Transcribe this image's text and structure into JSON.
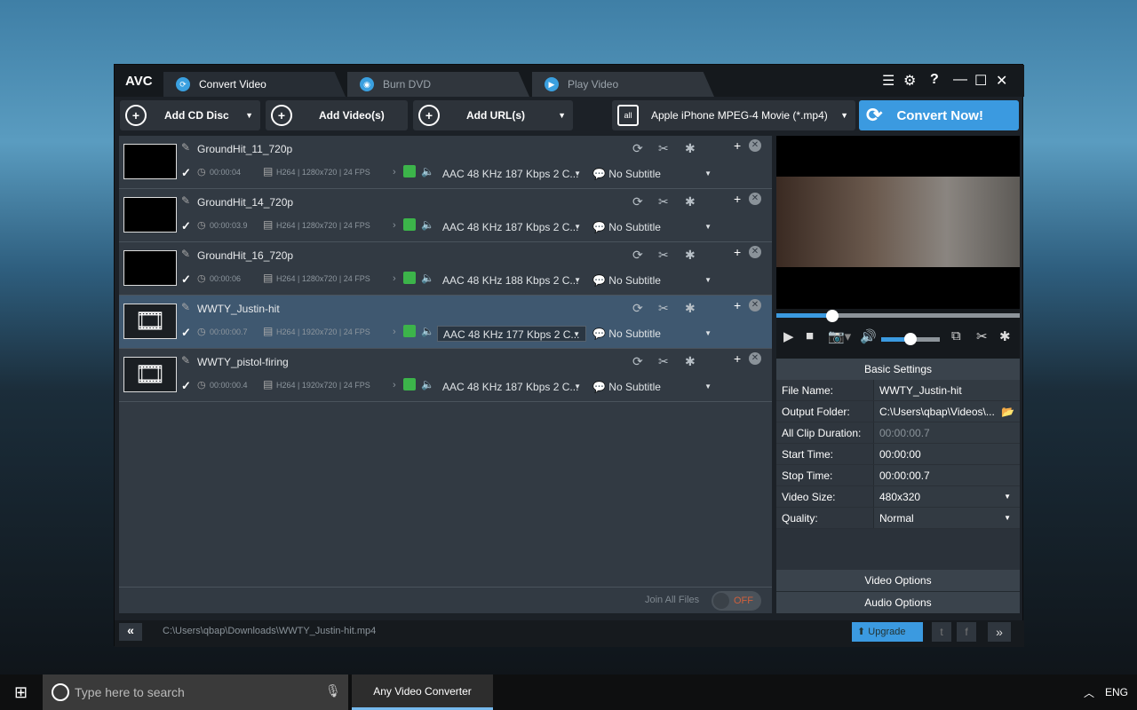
{
  "app": {
    "logo": "AVC",
    "tabs": [
      {
        "label": "Convert Video",
        "icon": "refresh-icon"
      },
      {
        "label": "Burn DVD",
        "icon": "disc-icon"
      },
      {
        "label": "Play Video",
        "icon": "play-icon"
      }
    ]
  },
  "toolbar": {
    "add_cd": "Add CD Disc",
    "add_video": "Add Video(s)",
    "add_url": "Add URL(s)",
    "profile": "Apple iPhone MPEG-4 Movie (*.mp4)",
    "convert": "Convert Now!"
  },
  "files": [
    {
      "name": "GroundHit_11_720p",
      "duration": "00:00:04",
      "video": "H264 | 1280x720 | 24 FPS",
      "audio": "AAC 48 KHz 187 Kbps 2 C...",
      "subtitle": "No Subtitle",
      "selected": false
    },
    {
      "name": "GroundHit_14_720p",
      "duration": "00:00:03.9",
      "video": "H264 | 1280x720 | 24 FPS",
      "audio": "AAC 48 KHz 187 Kbps 2 C...",
      "subtitle": "No Subtitle",
      "selected": false
    },
    {
      "name": "GroundHit_16_720p",
      "duration": "00:00:06",
      "video": "H264 | 1280x720 | 24 FPS",
      "audio": "AAC 48 KHz 188 Kbps 2 C...",
      "subtitle": "No Subtitle",
      "selected": false
    },
    {
      "name": "WWTY_Justin-hit",
      "duration": "00:00:00.7",
      "video": "H264 | 1920x720 | 24 FPS",
      "audio": "AAC 48 KHz 177 Kbps 2 C...",
      "subtitle": "No Subtitle",
      "selected": true
    },
    {
      "name": "WWTY_pistol-firing",
      "duration": "00:00:00.4",
      "video": "H264 | 1920x720 | 24 FPS",
      "audio": "AAC 48 KHz 187 Kbps 2 C...",
      "subtitle": "No Subtitle",
      "selected": false
    }
  ],
  "join": {
    "label": "Join All Files",
    "state": "OFF"
  },
  "player": {
    "progress": 0.23,
    "volume": 0.5
  },
  "settings": {
    "title": "Basic Settings",
    "rows": [
      {
        "k": "File Name:",
        "v": "WWTY_Justin-hit"
      },
      {
        "k": "Output Folder:",
        "v": "C:\\Users\\qbap\\Videos\\..."
      },
      {
        "k": "All Clip Duration:",
        "v": "00:00:00.7"
      },
      {
        "k": "Start Time:",
        "v": "00:00:00"
      },
      {
        "k": "Stop Time:",
        "v": "00:00:00.7"
      },
      {
        "k": "Video Size:",
        "v": "480x320"
      },
      {
        "k": "Quality:",
        "v": "Normal"
      }
    ],
    "video_options": "Video Options",
    "audio_options": "Audio Options"
  },
  "status": {
    "path": "C:\\Users\\qbap\\Downloads\\WWTY_Justin-hit.mp4",
    "upgrade": "Upgrade"
  },
  "taskbar": {
    "search_placeholder": "Type here to search",
    "app": "Any Video Converter",
    "lang": "ENG"
  },
  "colors": {
    "accent": "#3b9ae0",
    "selected_row": "#3f5870"
  }
}
